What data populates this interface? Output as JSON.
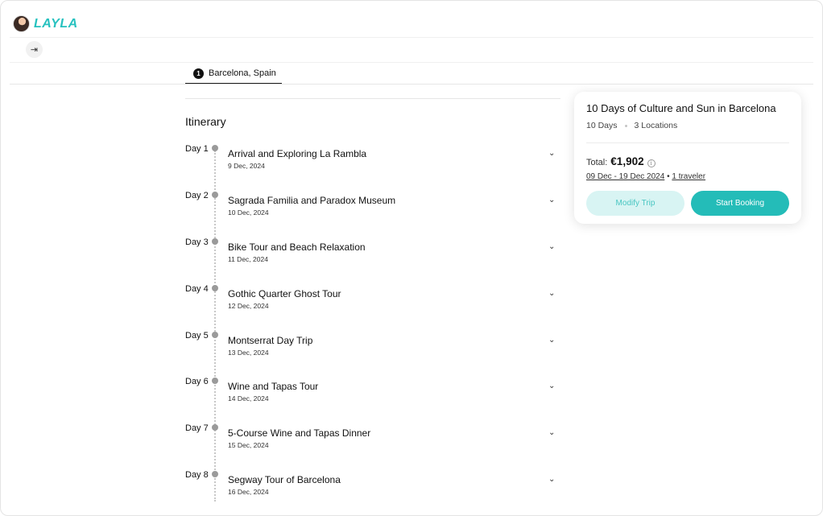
{
  "brand": {
    "name": "LAYLA"
  },
  "header": {
    "collapse_icon": "sidebar-expand-icon"
  },
  "tabs": [
    {
      "number": "1",
      "label": "Barcelona, Spain"
    }
  ],
  "itinerary": {
    "title": "Itinerary",
    "days": [
      {
        "label": "Day 1",
        "title": "Arrival and Exploring La Rambla",
        "date": "9 Dec, 2024"
      },
      {
        "label": "Day 2",
        "title": "Sagrada Familia and Paradox Museum",
        "date": "10 Dec, 2024"
      },
      {
        "label": "Day 3",
        "title": "Bike Tour and Beach Relaxation",
        "date": "11 Dec, 2024"
      },
      {
        "label": "Day 4",
        "title": "Gothic Quarter Ghost Tour",
        "date": "12 Dec, 2024"
      },
      {
        "label": "Day 5",
        "title": "Montserrat Day Trip",
        "date": "13 Dec, 2024"
      },
      {
        "label": "Day 6",
        "title": "Wine and Tapas Tour",
        "date": "14 Dec, 2024"
      },
      {
        "label": "Day 7",
        "title": "5-Course Wine and Tapas Dinner",
        "date": "15 Dec, 2024"
      },
      {
        "label": "Day 8",
        "title": "Segway Tour of Barcelona",
        "date": "16 Dec, 2024"
      }
    ]
  },
  "summary": {
    "title": "10 Days of Culture and Sun in Barcelona",
    "days": "10 Days",
    "locations": "3 Locations",
    "total_label": "Total:",
    "total_value": "€1,902",
    "date_range": "09 Dec - 19 Dec 2024",
    "separator": "•",
    "travelers": "1 traveler",
    "modify_label": "Modify Trip",
    "book_label": "Start Booking"
  },
  "colors": {
    "accent": "#24bcb8",
    "accent_light": "#d8f4f3"
  }
}
